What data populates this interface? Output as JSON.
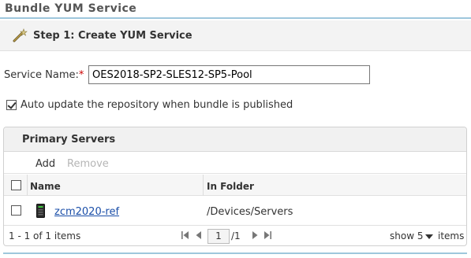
{
  "page": {
    "title": "Bundle YUM Service",
    "step_title": "Step 1: Create YUM Service"
  },
  "form": {
    "service_name_label": "Service Name:",
    "required_marker": "*",
    "service_name_value": "OES2018-SP2-SLES12-SP5-Pool",
    "auto_update_checked": true,
    "auto_update_label": "Auto update the repository when bundle is published"
  },
  "primary_servers": {
    "title": "Primary Servers",
    "toolbar": {
      "add_label": "Add",
      "remove_label": "Remove"
    },
    "columns": {
      "name": "Name",
      "folder": "In Folder"
    },
    "rows": [
      {
        "name": "zcm2020-ref",
        "folder": "/Devices/Servers",
        "checked": false
      }
    ],
    "pager": {
      "count_text": "1 - 1 of 1 items",
      "first_icon": "first-page-icon",
      "prev_icon": "prev-page-icon",
      "current_page": "1",
      "of_pages": "/1",
      "next_icon": "next-page-icon",
      "last_icon": "last-page-icon",
      "show_label": "show",
      "show_value": "5",
      "items_label": "items"
    }
  },
  "colors": {
    "accent_rule": "#9ec7dc",
    "link": "#1a4ea8",
    "required": "#cc0000",
    "disabled": "#b5b5b5"
  }
}
